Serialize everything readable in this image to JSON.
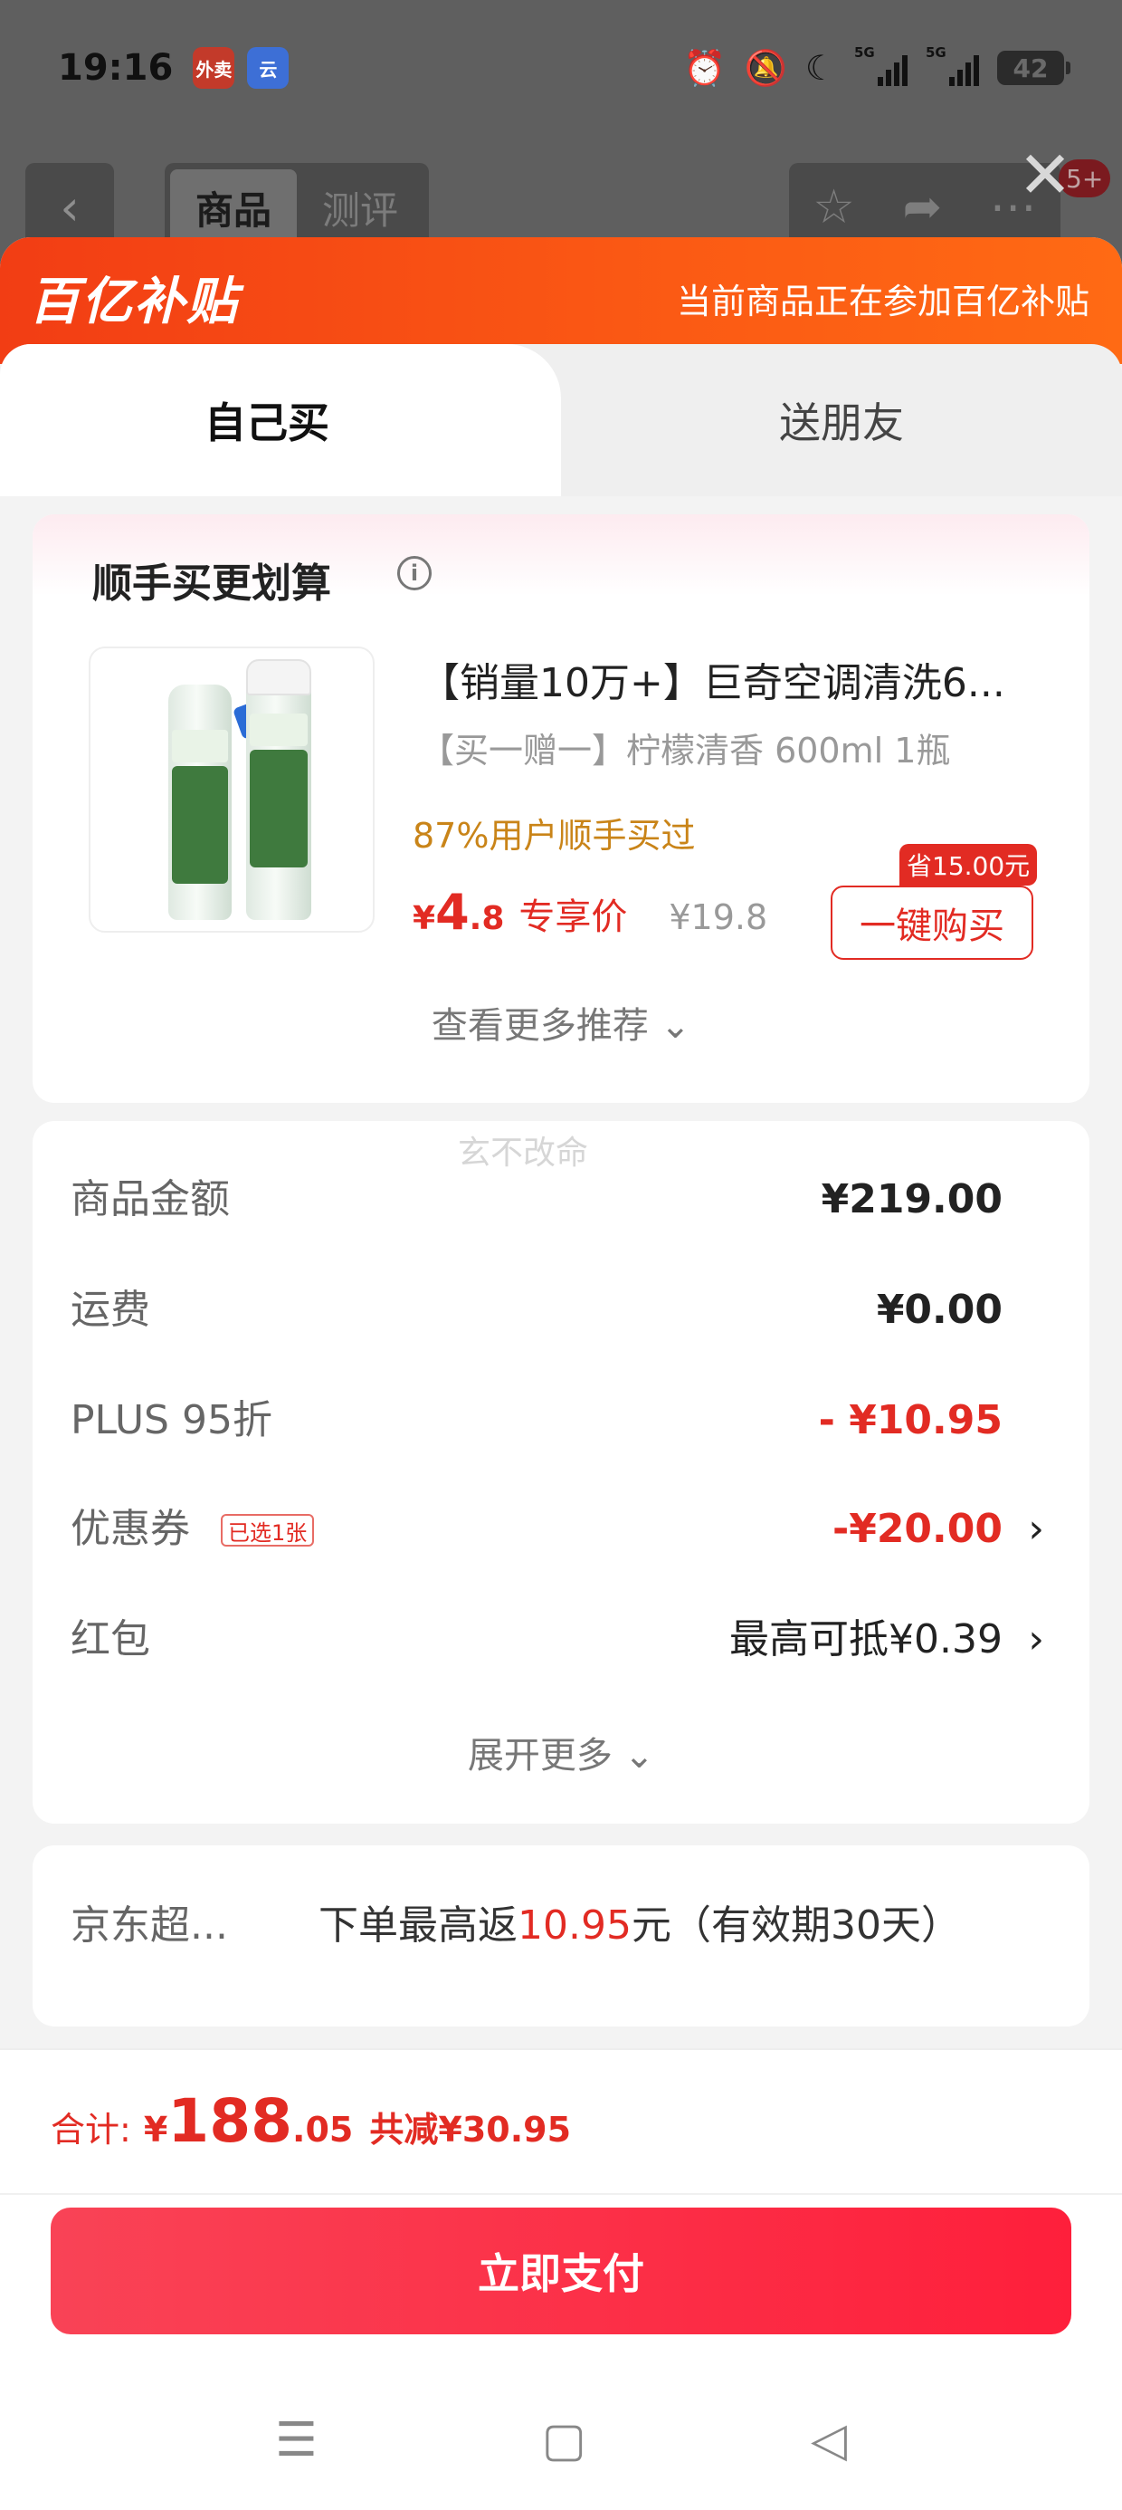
{
  "status_bar": {
    "time": "19:16",
    "apps": [
      "外卖",
      "云"
    ],
    "icons": [
      "alarm-icon",
      "bell-off-icon",
      "moon-icon",
      "signal-5g-icon",
      "signal-5g-icon"
    ],
    "signal_label": "5G",
    "battery": "42"
  },
  "background_nav": {
    "back_icon": "chevron-left-icon",
    "tabs": [
      "商品",
      "测评"
    ],
    "actions": [
      "star-icon",
      "share-icon",
      "more-icon"
    ],
    "badge": "5+"
  },
  "sheet": {
    "brand": "百亿补贴",
    "brand_note": "当前商品正在参加百亿补贴",
    "tabs": [
      "自己买",
      "送朋友"
    ],
    "recommend": {
      "title": "顺手买更划算",
      "product_name": "【销量10万+】巨奇空调清洗6...",
      "spec": "【买一赠一】柠檬清香 600ml 1瓶",
      "bought": "87%用户顺手买过",
      "price_symbol": "¥",
      "price_int": "4",
      "price_dec": ".8",
      "price_tag": "专享价",
      "original_price": "¥19.8",
      "save_tag": "省15.00元",
      "buy_button": "一键购买",
      "more": "查看更多推荐 ⌄"
    },
    "watermark": "玄不改命",
    "details": [
      {
        "label": "商品金额",
        "value": "¥219.00"
      },
      {
        "label": "运费",
        "value": "¥0.00"
      },
      {
        "label": "PLUS 95折",
        "value": "- ¥10.95"
      },
      {
        "label": "优惠券",
        "chip": "已选1张",
        "value": "-¥20.00"
      },
      {
        "label": "红包",
        "value": "最高可抵¥0.39"
      }
    ],
    "expand": "展开更多 ⌄",
    "cashback": {
      "label": "京东超...",
      "prefix": "下单最高返",
      "amount": "10.95",
      "suffix": "元（有效期30天）"
    },
    "total": {
      "label": "合计:",
      "symbol": "¥",
      "int": "188",
      "dec": ".05",
      "reduce": "共减¥30.95"
    },
    "pay_button": "立即支付"
  },
  "system_nav": [
    "menu-icon",
    "home-icon",
    "back-icon"
  ]
}
